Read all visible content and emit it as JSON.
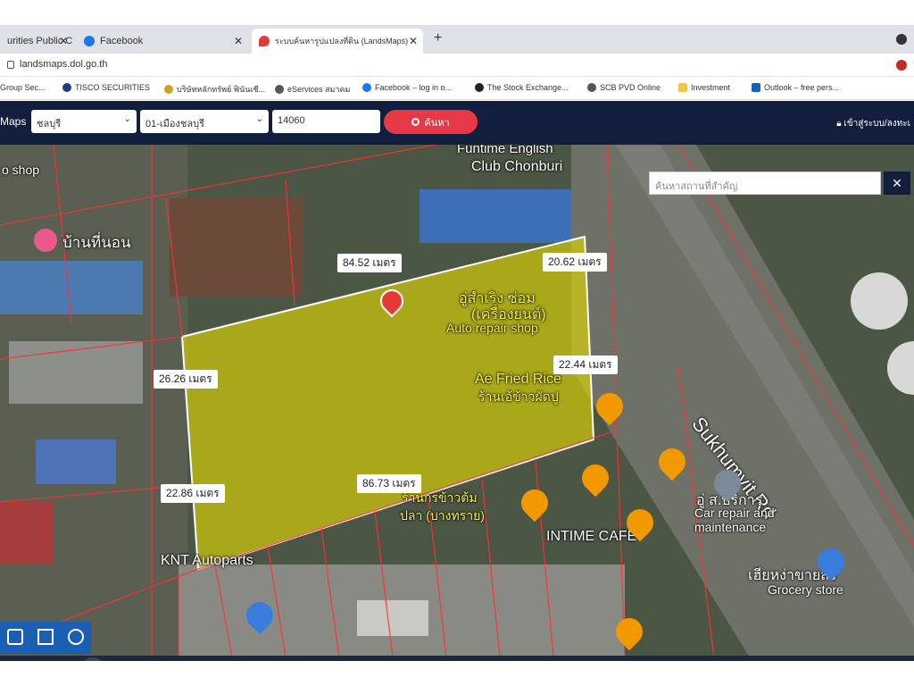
{
  "browser": {
    "tabs": [
      {
        "label": "urities Public C"
      },
      {
        "label": "Facebook"
      },
      {
        "label": "ระบบค้นหารูปแปลงที่ดิน (LandsMaps)"
      }
    ],
    "new_tab": "+",
    "url": "landsmaps.dol.go.th",
    "bookmarks": [
      "Group Sec...",
      "TISCO SECURITIES",
      "บริษัทหลักทรัพย์ ฟินันเซี...",
      "eServices สมาคม",
      "Facebook – log in o...",
      "The Stock Exchange...",
      "SCB PVD Online",
      "Investment",
      "Outlook – free pers..."
    ]
  },
  "navbar": {
    "brand": "Maps",
    "province": "ชลบุรี",
    "district": "01-เมืองชลบุรี",
    "parcel_no": "14060",
    "search_label": "ค้นหา",
    "login_label": "เข้าสู่ระบบ/ลงทะเ"
  },
  "map": {
    "search_placeholder": "ค้นหาสถานที่สำคัญ",
    "close": "✕",
    "labels": {
      "funtime_1": "Funtime English",
      "funtime_2": "Club Chonburi",
      "ban_thi_non": "บ้านที่นอน",
      "shop_top": "o shop",
      "auto_repair_th1": "อู่สำเริง ซ่อม",
      "auto_repair_th2": "(เครื่องยนต์)",
      "auto_repair_en": "Auto repair shop",
      "fried_rice": "Ae Fried Rice",
      "fried_rice_th": "ร้านเอ้ข้าวผัดปู",
      "jok_1": "ร้านกรข้าวต้ม",
      "jok_2": "ปลา (บางทราย)",
      "intime": "INTIME CAFE",
      "knt": "KNT Autoparts",
      "sukhumvit": "Sukhumvit Rd",
      "car_repair_th": "อู่ ส.บริการ",
      "car_repair_1": "Car repair and",
      "car_repair_2": "maintenance",
      "grocery_th": "เฮียหง่าขายส่ง",
      "grocery": "Grocery store"
    },
    "measurements": {
      "top": "84.52 เมตร",
      "top_right": "20.62 เมตร",
      "left": "26.26 เมตร",
      "right": "22.44 เมตร",
      "bottom": "86.73 เมตร",
      "bottom_left": "22.86 เมตร"
    },
    "parcel_color": "#e8e000",
    "pin_color": "#e53935",
    "food_poi_color": "#f29900"
  }
}
